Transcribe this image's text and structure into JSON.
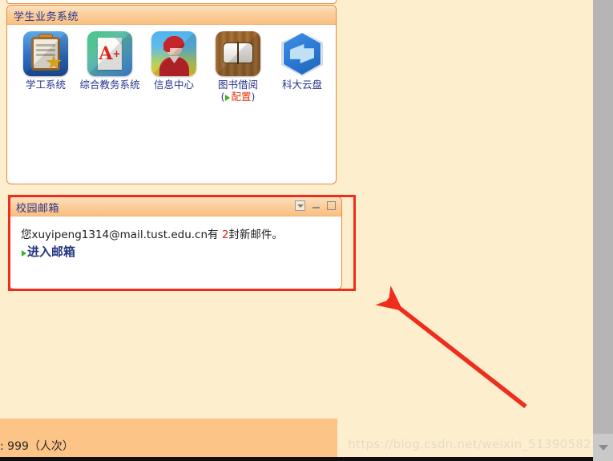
{
  "colors": {
    "page_background": "#fdeecd",
    "panel_border": "#e8893b",
    "panel_header_gradient_top": "#fde0bd",
    "panel_header_gradient_bottom": "#f9c081",
    "title_text": "#28348c",
    "annotation_red": "#ef2d1c",
    "link_blue": "#22357e",
    "new_mail_count_red": "#e02020",
    "config_link_red": "#e8340c",
    "green_triangle": "#3cb521",
    "bottom_bar_orange": "#fcc486",
    "watermark": "#e6dcc4"
  },
  "student_panel": {
    "title": "学生业务系统",
    "apps": [
      {
        "label": "学工系统",
        "icon": "clipboard-star-icon"
      },
      {
        "label": "综合教务系统",
        "icon": "a-plus-document-icon"
      },
      {
        "label": "信息中心",
        "icon": "person-avatar-icon"
      },
      {
        "label": "图书借阅",
        "icon": "open-book-icon",
        "config_prefix": "(",
        "config_label": "配置",
        "config_suffix": ")"
      },
      {
        "label": "科大云盘",
        "icon": "hexagon-cloud-disk-icon"
      }
    ]
  },
  "mail_panel": {
    "title": "校园邮箱",
    "message_prefix": "您xuyipeng1314@mail.tust.edu.cn有 ",
    "message_count": "2",
    "message_suffix": "封新邮件。",
    "enter_mailbox_label": "进入邮箱",
    "window_buttons": [
      {
        "name": "dropdown",
        "icon": "chevron-down-box-icon"
      },
      {
        "name": "minimize",
        "icon": "minimize-icon"
      },
      {
        "name": "maximize",
        "icon": "maximize-icon"
      }
    ]
  },
  "bottom_bar": {
    "visit_counter_text": ": 999（人次）"
  },
  "watermark": {
    "text": "https://blog.csdn.net/weixin_51390582"
  },
  "scrollbar": {
    "down_arrow_icon": "chevron-down-icon"
  }
}
